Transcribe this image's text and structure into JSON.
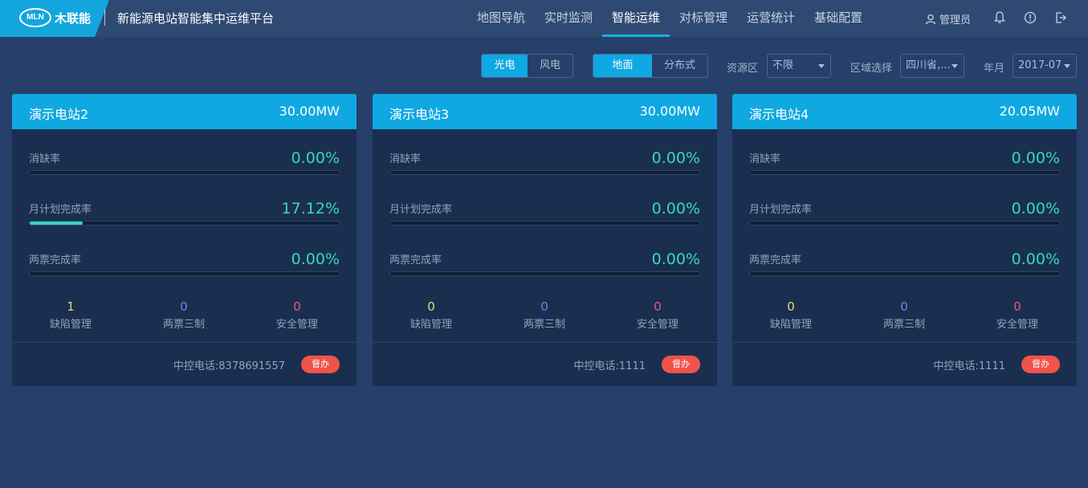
{
  "header": {
    "logo_mark": "MLN",
    "logo_text": "木联能",
    "app_title": "新能源电站智能集中运维平台",
    "nav": [
      "地图导航",
      "实时监测",
      "智能运维",
      "对标管理",
      "运营统计",
      "基础配置"
    ],
    "active_nav": "智能运维",
    "user": "管理员",
    "icons": [
      "user-icon",
      "bell-icon",
      "alert-icon",
      "logout-icon"
    ]
  },
  "filters": {
    "energy_type": [
      "光电",
      "风电"
    ],
    "energy_active": "光电",
    "install_type": [
      "地面",
      "分布式"
    ],
    "install_active": "地面",
    "resource_label": "资源区",
    "resource_value": "不限",
    "region_label": "区域选择",
    "region_value": "四川省,...",
    "month_label": "年月",
    "month_value": "2017-07"
  },
  "cards": [
    {
      "name": "演示电站2",
      "capacity": "30.00MW",
      "metrics": [
        {
          "label": "消缺率",
          "value": "0.00%",
          "fraction": 0.0
        },
        {
          "label": "月计划完成率",
          "value": "17.12%",
          "fraction": 0.1712
        },
        {
          "label": "两票完成率",
          "value": "0.00%",
          "fraction": 0.0
        }
      ],
      "counts": [
        {
          "num": "1",
          "label": "缺陷管理"
        },
        {
          "num": "0",
          "label": "两票三制"
        },
        {
          "num": "0",
          "label": "安全管理"
        }
      ],
      "phone": "中控电话:8378691557",
      "button": "督办"
    },
    {
      "name": "演示电站3",
      "capacity": "30.00MW",
      "metrics": [
        {
          "label": "消缺率",
          "value": "0.00%",
          "fraction": 0.0
        },
        {
          "label": "月计划完成率",
          "value": "0.00%",
          "fraction": 0.0
        },
        {
          "label": "两票完成率",
          "value": "0.00%",
          "fraction": 0.0
        }
      ],
      "counts": [
        {
          "num": "0",
          "label": "缺陷管理"
        },
        {
          "num": "0",
          "label": "两票三制"
        },
        {
          "num": "0",
          "label": "安全管理"
        }
      ],
      "phone": "中控电话:1111",
      "button": "督办"
    },
    {
      "name": "演示电站4",
      "capacity": "20.05MW",
      "metrics": [
        {
          "label": "消缺率",
          "value": "0.00%",
          "fraction": 0.0
        },
        {
          "label": "月计划完成率",
          "value": "0.00%",
          "fraction": 0.0
        },
        {
          "label": "两票完成率",
          "value": "0.00%",
          "fraction": 0.0
        }
      ],
      "counts": [
        {
          "num": "0",
          "label": "缺陷管理"
        },
        {
          "num": "0",
          "label": "两票三制"
        },
        {
          "num": "0",
          "label": "安全管理"
        }
      ],
      "phone": "中控电话:1111",
      "button": "督办"
    }
  ],
  "colors": {
    "accent": "#0fa8e2",
    "progress": "#35d9bc",
    "count_defect": "#e8d873",
    "count_ticket": "#7c7cf0",
    "count_safety": "#f0547a",
    "button": "#f0534a"
  }
}
